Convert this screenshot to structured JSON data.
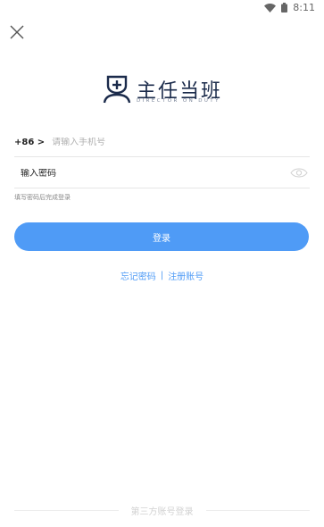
{
  "status_bar": {
    "time": "8:11"
  },
  "logo": {
    "title": "主任当班",
    "subtitle": "DIRECTOR ON DUTY"
  },
  "phone": {
    "country_code": "+86 >",
    "placeholder": "请输入手机号"
  },
  "password": {
    "placeholder": "输入密码"
  },
  "hint": "填写密码后完成登录",
  "login_button": "登录",
  "links": {
    "forgot": "忘记密码",
    "separator": "|",
    "register": "注册账号"
  },
  "third_party": {
    "label": "第三方账号登录"
  },
  "colors": {
    "accent": "#4f9bf6",
    "logo": "#1b2b4b"
  }
}
